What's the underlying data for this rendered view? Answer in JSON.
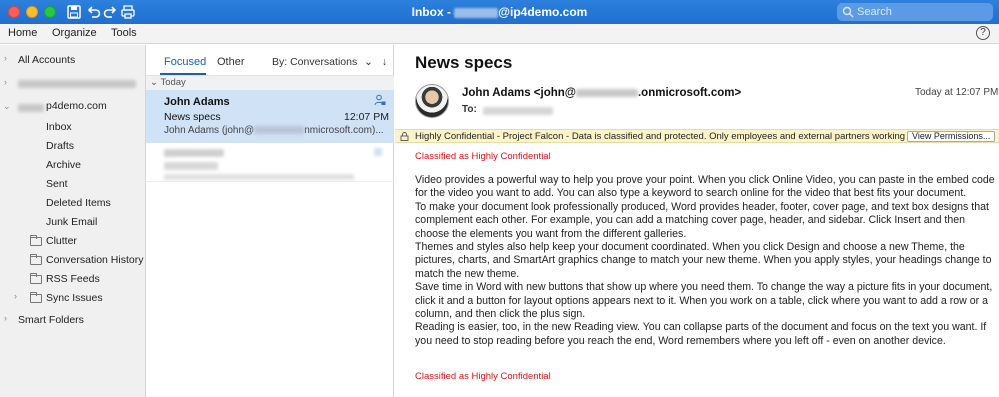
{
  "window": {
    "title_prefix": "Inbox - ",
    "title_suffix": "@ip4demo.com",
    "search_placeholder": "Search"
  },
  "menu": {
    "items": [
      "Home",
      "Organize",
      "Tools"
    ],
    "help": "?"
  },
  "sidebar": {
    "all_accounts": "All Accounts",
    "account_suffix": "p4demo.com",
    "folders": [
      "Inbox",
      "Drafts",
      "Archive",
      "Sent",
      "Deleted Items",
      "Junk Email"
    ],
    "subfolders": [
      "Clutter",
      "Conversation History",
      "RSS Feeds",
      "Sync Issues"
    ],
    "smart_folders": "Smart Folders"
  },
  "message_list": {
    "tab_focused": "Focused",
    "tab_other": "Other",
    "sort": "By: Conversations",
    "group": "Today",
    "selected": {
      "from": "John Adams",
      "subject": "News specs",
      "time": "12:07 PM",
      "preview_prefix": "John Adams (john@",
      "preview_suffix": "nmicrosoft.com)..."
    }
  },
  "reading": {
    "subject": "News specs",
    "sender_prefix": "John Adams <john@",
    "sender_suffix": ".onmicrosoft.com>",
    "to_label": "To:",
    "timestamp": "Today at 12:07 PM",
    "banner_text": "Highly Confidential - Project Falcon - Data is classified and protected. Only employees and external partners working o...",
    "view_permissions": "View Permissions...",
    "classified": "Classified as Highly Confidential",
    "paragraphs": [
      "Video provides a powerful way to help you prove your point. When you click Online Video, you can paste in the embed code for the video you want to add. You can also type a keyword to search online for the video that best fits your document.",
      "To make your document look professionally produced, Word provides header, footer, cover page, and text box designs that complement each other. For example, you can add a matching cover page, header, and sidebar. Click Insert and then choose the elements you want from the different galleries.",
      "Themes and styles also help keep your document coordinated. When you click Design and choose a new Theme, the pictures, charts, and SmartArt graphics change to match your new theme. When you apply styles, your headings change to match the new theme.",
      "Save time in Word with new buttons that show up where you need them. To change the way a picture fits in your document, click it and a button for layout options appears next to it. When you work on a table, click where you want to add a row or a column, and then click the plus sign.",
      "Reading is easier, too, in the new Reading view. You can collapse parts of the document and focus on the text you want. If you need to stop reading before you reach the end, Word remembers where you left off - even on another device."
    ]
  }
}
